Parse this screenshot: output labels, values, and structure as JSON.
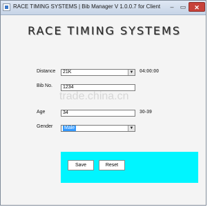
{
  "window": {
    "title": "RACE TIMING SYSTEMS | Bib Manager V 1.0.0.7 for Client",
    "minimize_glyph": "–",
    "maximize_glyph": "▭",
    "close_glyph": "✕"
  },
  "header": {
    "logo_text": "RACE TIMING SYSTEMS"
  },
  "form": {
    "distance": {
      "label": "Distance",
      "value": "21K",
      "hint": "04:00:00"
    },
    "bib_no": {
      "label": "Bib No.",
      "value": "1234"
    },
    "age": {
      "label": "Age",
      "value": "34",
      "hint": "30-39"
    },
    "gender": {
      "label": "Gender",
      "value": "Male"
    }
  },
  "buttons": {
    "save_label": "Save",
    "reset_label": "Reset"
  },
  "watermark": {
    "text": "trade.china.cn"
  },
  "colors": {
    "button_panel_bg": "#00f5ff",
    "selected_option_bg": "#3399ff",
    "close_button_bg": "#c7423a"
  },
  "icons": {
    "dropdown_arrow": "chevron-down-icon",
    "app": "app-icon"
  }
}
